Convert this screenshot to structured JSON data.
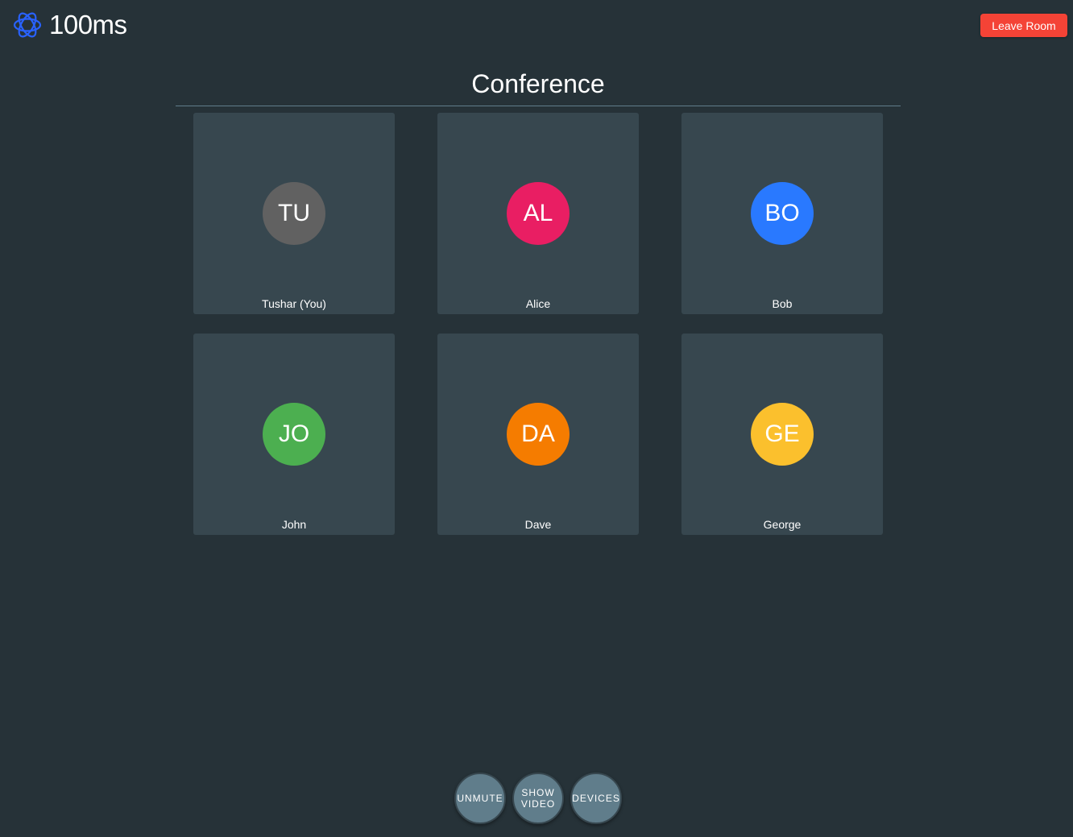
{
  "header": {
    "logo_text": "100ms",
    "leave_label": "Leave Room"
  },
  "conference": {
    "title": "Conference"
  },
  "peers": [
    {
      "initials": "TU",
      "name": "Tushar (You)",
      "color": "#616161"
    },
    {
      "initials": "AL",
      "name": "Alice",
      "color": "#e91e63"
    },
    {
      "initials": "BO",
      "name": "Bob",
      "color": "#2979ff"
    },
    {
      "initials": "JO",
      "name": "John",
      "color": "#4caf50"
    },
    {
      "initials": "DA",
      "name": "Dave",
      "color": "#f57c00"
    },
    {
      "initials": "GE",
      "name": "George",
      "color": "#fbc02d"
    }
  ],
  "controls": {
    "mute_label": "UNMUTE",
    "video_label_line1": "SHOW",
    "video_label_line2": "VIDEO",
    "devices_label": "DEVICES"
  },
  "colors": {
    "background": "#263238",
    "tile": "#37474f",
    "leave_button": "#f44336",
    "control_button": "#607d8b",
    "logo_accent": "#2962ff"
  }
}
